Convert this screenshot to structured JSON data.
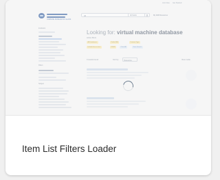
{
  "card": {
    "caption": "Item List Filters Loader"
  },
  "header": {
    "top_links": [
      "Join Now",
      "Get Started"
    ],
    "logo_text": "CORNING MUSEUM OF GLASS",
    "search_value": "All",
    "scope_label": "All Fields",
    "institution_label": "My DAR Resources"
  },
  "results": {
    "title_prefix": "Looking for:",
    "query": "virtual machine database",
    "filters_label": "Active filters",
    "chips": [
      "All Databases",
      "Public IRA",
      "Content Type",
      "Include free access",
      "USER",
      "Clear All",
      "Save Search"
    ],
    "toolbar": {
      "count_text": "0 results found",
      "sort_label": "Sort by:",
      "sort_value": "Relevance",
      "view_label": "View mode"
    }
  },
  "sidebar": {
    "sections": [
      "Institution",
      "Filters",
      "Subject"
    ]
  },
  "colors": {
    "accent": "#1f4f98",
    "chip": "#fbe8a8",
    "spinner": "#6d7e90"
  },
  "icons": {
    "loader": "spinner-icon",
    "search": "search-icon"
  }
}
